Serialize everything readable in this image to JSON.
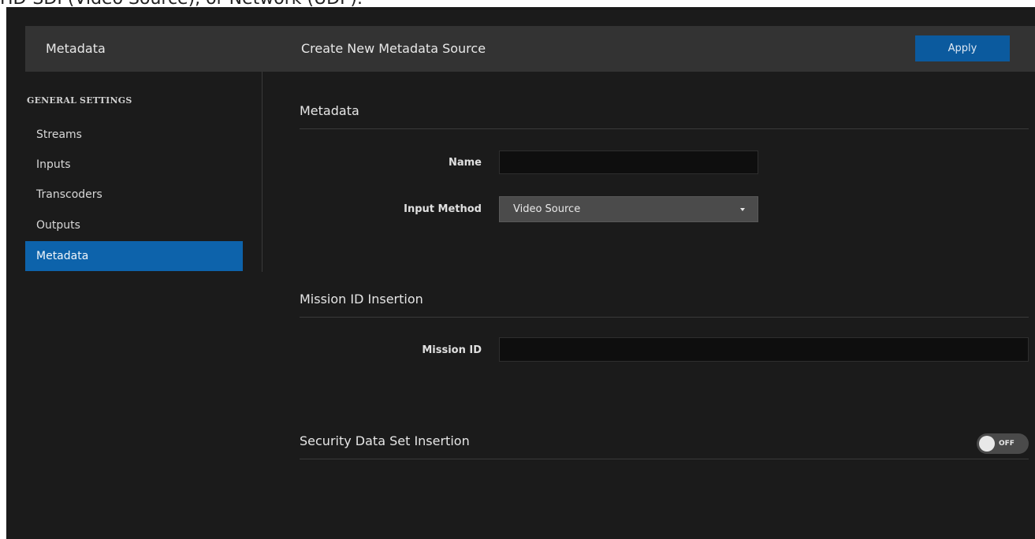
{
  "doc_caption": "HD-SDI (Video Source), or Network (UDP).",
  "header": {
    "left_title": "Metadata",
    "title": "Create New Metadata Source",
    "apply_label": "Apply"
  },
  "sidebar": {
    "heading": "GENERAL SETTINGS",
    "items": [
      {
        "label": "Streams",
        "active": false
      },
      {
        "label": "Inputs",
        "active": false
      },
      {
        "label": "Transcoders",
        "active": false
      },
      {
        "label": "Outputs",
        "active": false
      },
      {
        "label": "Metadata",
        "active": true
      }
    ]
  },
  "metadata_section": {
    "title": "Metadata",
    "name_label": "Name",
    "name_value": "",
    "input_method_label": "Input Method",
    "input_method_value": "Video Source"
  },
  "mission_section": {
    "title": "Mission ID Insertion",
    "mission_id_label": "Mission ID",
    "mission_id_value": ""
  },
  "security_section": {
    "title": "Security Data Set Insertion",
    "toggle_label": "OFF",
    "toggle_on": false
  },
  "colors": {
    "accent": "#0d63ab",
    "background": "#1b1b1b",
    "header": "#333333"
  }
}
